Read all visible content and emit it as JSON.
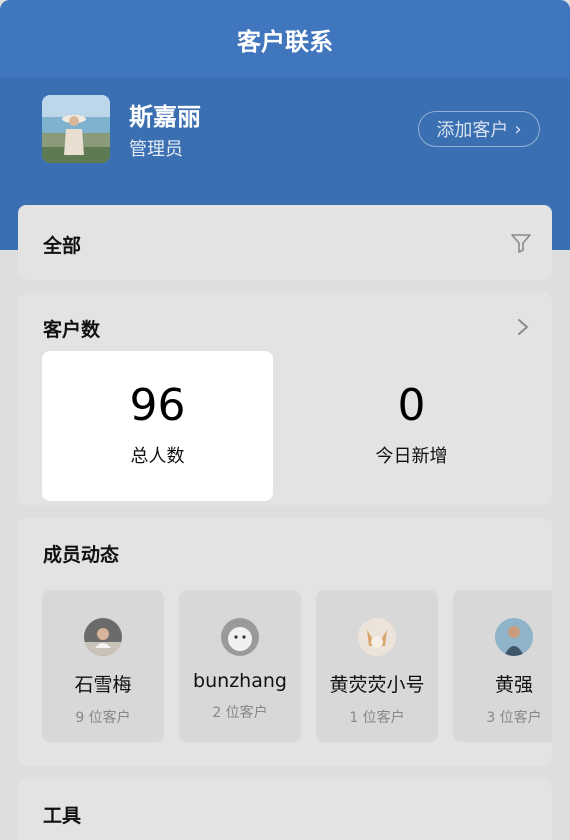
{
  "header": {
    "title": "客户联系"
  },
  "profile": {
    "name": "斯嘉丽",
    "role": "管理员",
    "add_label": "添加客户",
    "add_arrow": "›"
  },
  "filter": {
    "label": "全部",
    "icon": "filter-icon"
  },
  "customers": {
    "label": "客户数",
    "total": {
      "value": "96",
      "caption": "总人数"
    },
    "today": {
      "value": "0",
      "caption": "今日新增"
    }
  },
  "members": {
    "label": "成员动态",
    "items": [
      {
        "name": "石雪梅",
        "count": "9 位客户"
      },
      {
        "name": "bunzhang",
        "count": "2 位客户"
      },
      {
        "name": "黄荧荧小号",
        "count": "1 位客户"
      },
      {
        "name": "黄强",
        "count": "3 位客户"
      }
    ]
  },
  "tools": {
    "label": "工具"
  },
  "colors": {
    "brand": "#3f76bd",
    "hero": "#3a6fb2",
    "background": "#dedede"
  }
}
